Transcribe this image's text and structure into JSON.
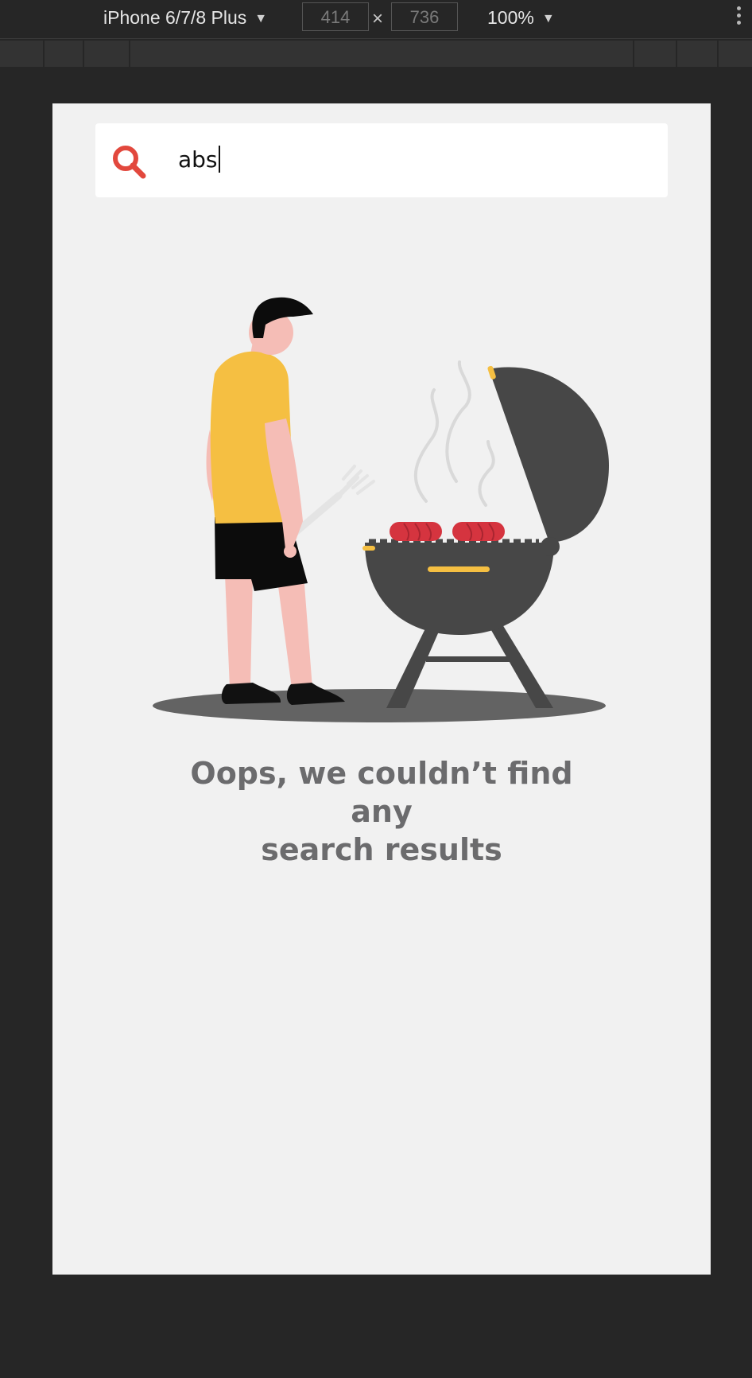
{
  "devtools": {
    "device_label": "iPhone 6/7/8 Plus",
    "width_value": "414",
    "height_value": "736",
    "dimension_separator": "×",
    "zoom_label": "100%"
  },
  "app": {
    "search": {
      "query": "abs",
      "icon": "search-icon",
      "icon_color": "#e2483d"
    },
    "empty_state": {
      "illustration": "person-at-barbecue-grill",
      "message_lines": [
        "Oops, we couldn’t find",
        "any",
        "search results"
      ]
    }
  },
  "colors": {
    "page_background": "#f1f1f1",
    "devtools_background": "#262626",
    "accent_red": "#e2483d",
    "shirt_yellow": "#f5bf42",
    "grill_dark": "#474747",
    "message_gray": "#6b6b6d"
  }
}
